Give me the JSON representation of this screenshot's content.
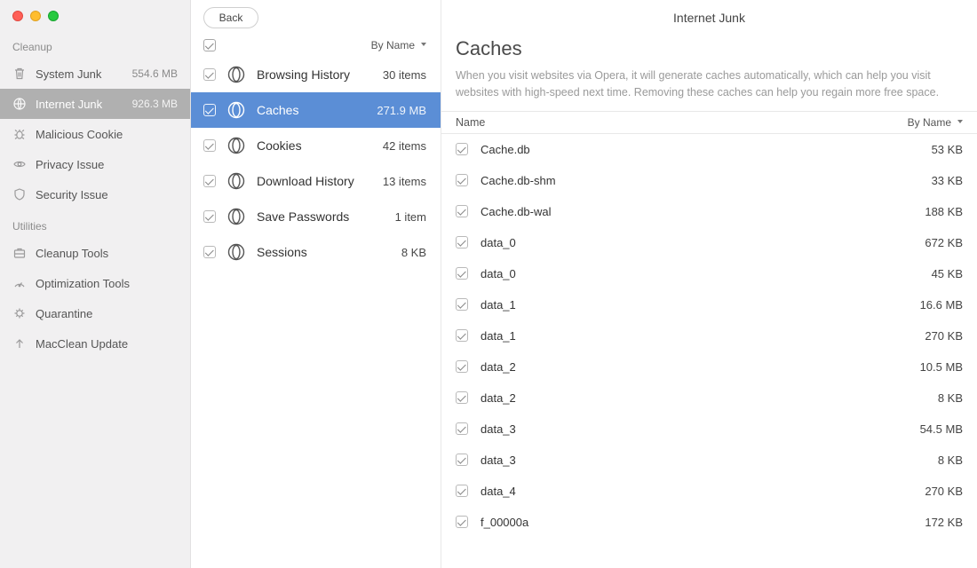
{
  "window": {
    "title": "Internet Junk"
  },
  "sidebar": {
    "section_cleanup": "Cleanup",
    "section_utilities": "Utilities",
    "cleanup": [
      {
        "label": "System Junk",
        "meta": "554.6 MB",
        "icon": "trash"
      },
      {
        "label": "Internet Junk",
        "meta": "926.3 MB",
        "icon": "globe",
        "active": true
      },
      {
        "label": "Malicious Cookie",
        "meta": "",
        "icon": "bug"
      },
      {
        "label": "Privacy Issue",
        "meta": "",
        "icon": "eye"
      },
      {
        "label": "Security Issue",
        "meta": "",
        "icon": "shield"
      }
    ],
    "utilities": [
      {
        "label": "Cleanup Tools",
        "icon": "briefcase"
      },
      {
        "label": "Optimization Tools",
        "icon": "gauge"
      },
      {
        "label": "Quarantine",
        "icon": "virus"
      },
      {
        "label": "MacClean Update",
        "icon": "up"
      }
    ]
  },
  "categories": {
    "back_label": "Back",
    "sort_label": "By Name",
    "items": [
      {
        "name": "Browsing History",
        "value": "30 items"
      },
      {
        "name": "Caches",
        "value": "271.9 MB",
        "selected": true
      },
      {
        "name": "Cookies",
        "value": "42 items"
      },
      {
        "name": "Download History",
        "value": "13 items"
      },
      {
        "name": "Save Passwords",
        "value": "1 item"
      },
      {
        "name": "Sessions",
        "value": "8 KB"
      }
    ]
  },
  "detail": {
    "title": "Caches",
    "description": "When you visit websites via Opera, it will generate caches automatically, which can help you visit websites with high-speed next time. Removing these caches can help you regain more free space.",
    "name_col": "Name",
    "sort_label": "By Name",
    "files": [
      {
        "name": "Cache.db",
        "size": "53 KB"
      },
      {
        "name": "Cache.db-shm",
        "size": "33 KB"
      },
      {
        "name": "Cache.db-wal",
        "size": "188 KB"
      },
      {
        "name": "data_0",
        "size": "672 KB"
      },
      {
        "name": "data_0",
        "size": "45 KB"
      },
      {
        "name": "data_1",
        "size": "16.6 MB"
      },
      {
        "name": "data_1",
        "size": "270 KB"
      },
      {
        "name": "data_2",
        "size": "10.5 MB"
      },
      {
        "name": "data_2",
        "size": "8 KB"
      },
      {
        "name": "data_3",
        "size": "54.5 MB"
      },
      {
        "name": "data_3",
        "size": "8 KB"
      },
      {
        "name": "data_4",
        "size": "270 KB"
      },
      {
        "name": "f_00000a",
        "size": "172 KB"
      }
    ]
  }
}
